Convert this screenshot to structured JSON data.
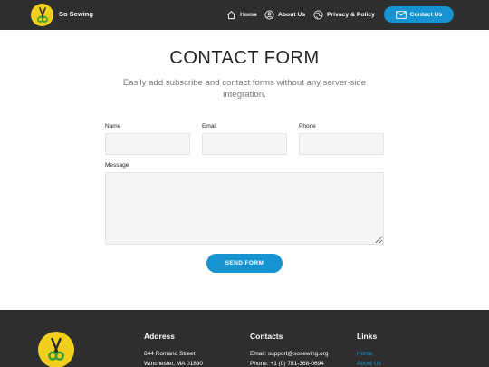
{
  "header": {
    "brand": "So Sewing",
    "nav": [
      {
        "label": "Home",
        "icon": "home-icon"
      },
      {
        "label": "About Us",
        "icon": "user-icon"
      },
      {
        "label": "Privacy & Policy",
        "icon": "globe-icon"
      }
    ],
    "contact_button": {
      "label": "Contact Us",
      "icon": "mail-icon"
    }
  },
  "main": {
    "title": "CONTACT FORM",
    "subtitle": "Easily add subscribe and contact forms without any server-side integration.",
    "form": {
      "name_label": "Name",
      "email_label": "Email",
      "phone_label": "Phone",
      "message_label": "Message",
      "name_value": "",
      "email_value": "",
      "phone_value": "",
      "message_value": "",
      "send_label": "SEND FORM"
    }
  },
  "footer": {
    "address": {
      "heading": "Address",
      "line1": "844 Romano Street",
      "line2": "Winchester, MA 01890"
    },
    "contacts": {
      "heading": "Contacts",
      "email": "Email: support@sosewing.org",
      "phone": "Phone: +1 (0) 781-368-0694"
    },
    "links": {
      "heading": "Links",
      "items": [
        "Home",
        "About Us"
      ]
    }
  },
  "colors": {
    "header_bg": "#2e2e2e",
    "accent": "#1793d1",
    "logo_yellow": "#f2cf1c",
    "field_bg": "#f5f5f5"
  }
}
